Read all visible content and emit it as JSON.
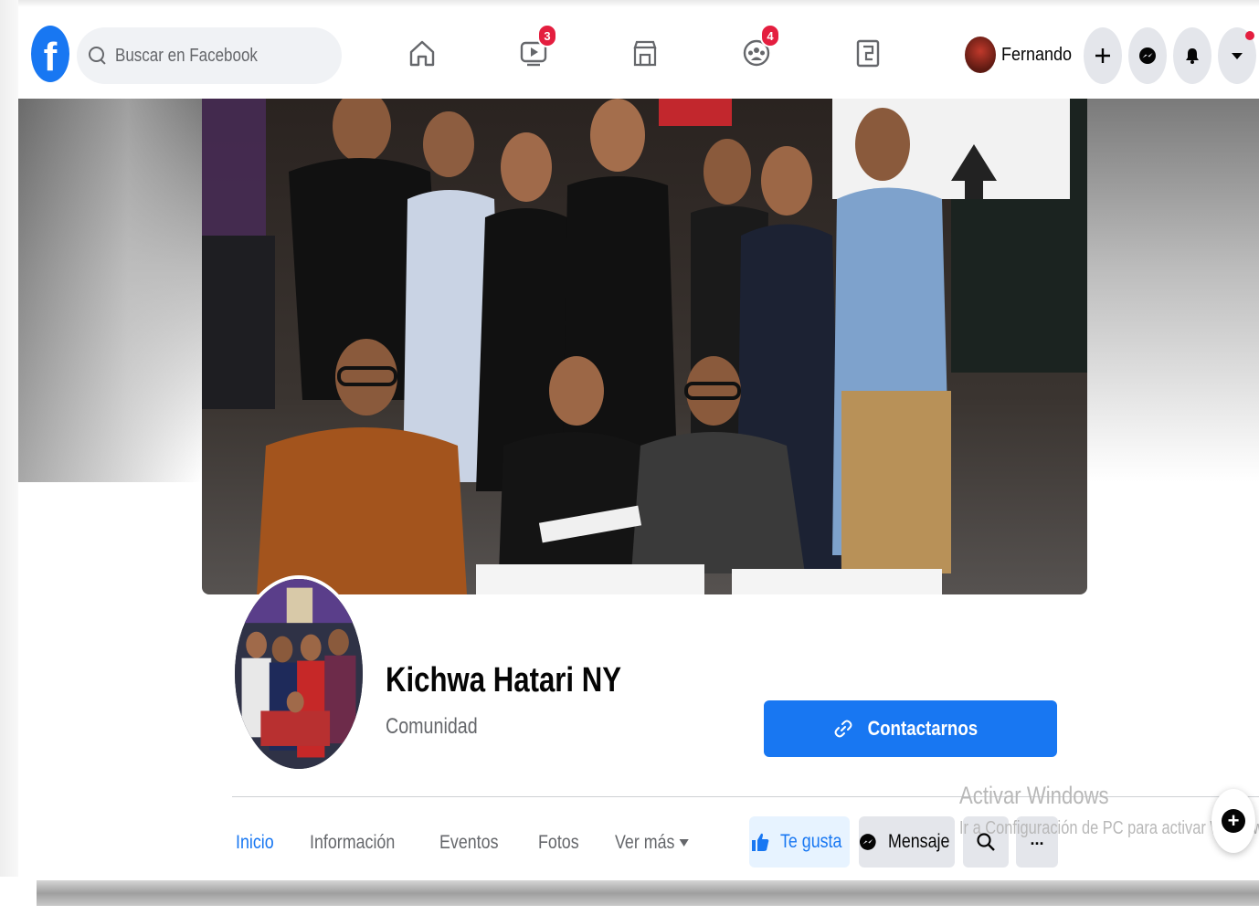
{
  "nav": {
    "logo": "f",
    "search_placeholder": "Buscar en Facebook",
    "icons": [
      "home-icon",
      "watch-icon",
      "marketplace-icon",
      "groups-icon",
      "gaming-icon"
    ],
    "watch_badge": "3",
    "groups_badge": "4",
    "user_name": "Fernando",
    "accent": "#1877f2",
    "badge_color": "#e41e3f"
  },
  "page": {
    "name": "Kichwa Hatari NY",
    "category": "Comunidad",
    "contact_label": "Contactarnos"
  },
  "tabs": [
    {
      "label": "Inicio",
      "active": true
    },
    {
      "label": "Información",
      "active": false
    },
    {
      "label": "Eventos",
      "active": false
    },
    {
      "label": "Fotos",
      "active": false
    },
    {
      "label": "Ver más",
      "active": false
    }
  ],
  "actions": {
    "like_label": "Te gusta",
    "message_label": "Mensaje",
    "more_label": "..."
  },
  "watermark": {
    "title": "Activar Windows",
    "subtitle": "Ir a Configuración de PC para activar Windows."
  },
  "fab": {
    "label": "+"
  }
}
